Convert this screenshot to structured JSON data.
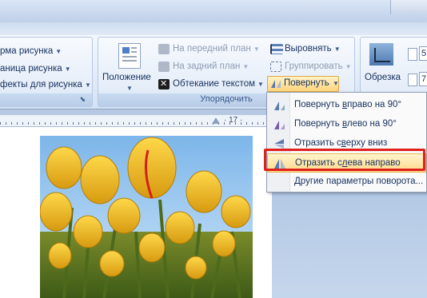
{
  "ribbon": {
    "styles_group": {
      "shape_label": "рма рисунка",
      "border_label": "аница рисунка",
      "effects_label": "фекты для рисунка"
    },
    "arrange_group": {
      "label": "Упорядочить",
      "position_label": "Положение",
      "bring_front_label": "На передний план",
      "send_back_label": "На задний план",
      "text_wrap_label": "Обтекание текстом",
      "align_label": "Выровнять",
      "group_label": "Группировать",
      "rotate_label": "Повернуть"
    },
    "size_group": {
      "crop_label": "Обрезка",
      "height_value": "5",
      "width_value": "7"
    }
  },
  "ruler": {
    "number": "· 17 ·"
  },
  "rotate_menu": {
    "items": [
      {
        "label": "Повернуть вправо на 90°",
        "underline": "в",
        "prefix": "Повернуть ",
        "suffix": "право на 90°"
      },
      {
        "label": "Повернуть влево на 90°",
        "prefix": "Повернуть ",
        "underline": "в",
        "suffix": "лево на 90°"
      },
      {
        "label": "Отразить сверху вниз",
        "prefix": "Отразить с",
        "underline": "в",
        "suffix": "ерху вниз"
      },
      {
        "label": "Отразить слева направо",
        "prefix": "Отразить с",
        "underline": "л",
        "suffix": "ева направо"
      },
      {
        "label": "Другие параметры поворота...",
        "prefix": "",
        "underline": "Д",
        "suffix": "ругие параметры поворота..."
      }
    ]
  },
  "colors": {
    "highlight": "#ffd98a",
    "red_frame": "#e0201c",
    "ribbon_text": "#15305c"
  }
}
